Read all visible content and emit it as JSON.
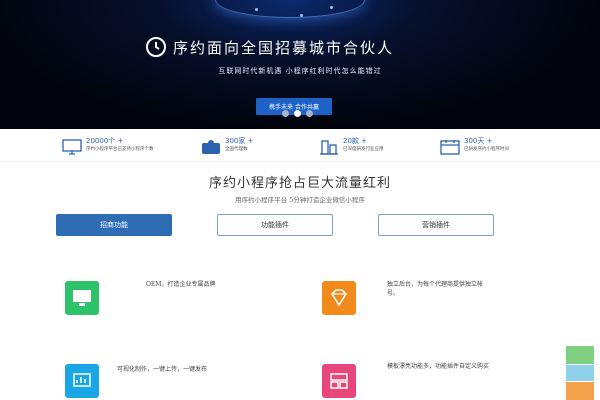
{
  "banner": {
    "title": "序约面向全国招募城市合伙人",
    "subtitle": "互联网时代新机遇 小程序红利时代怎么能错过",
    "cta_label": "携手未来 合作共赢",
    "icon": "clock-icon",
    "slides": 3,
    "active_slide": 1
  },
  "stats": [
    {
      "number": "20000个 +",
      "desc": "序约小程序平台已支持小程序个数",
      "icon": "monitor-icon"
    },
    {
      "number": "300家 +",
      "desc": "全国代理数",
      "icon": "handshake-icon"
    },
    {
      "number": "20款 +",
      "desc": "已深度研发行业应用",
      "icon": "building-icon"
    },
    {
      "number": "300天 +",
      "desc": "已研发序约小程序时间",
      "icon": "calendar-icon"
    }
  ],
  "section": {
    "title": "序约小程序抢占巨大流量红利",
    "subtitle": "用序约小程序平台 5分钟打造企业微信小程序"
  },
  "tabs": [
    {
      "label": "招商功能",
      "active": true
    },
    {
      "label": "功能插件",
      "active": false
    },
    {
      "label": "营销插件",
      "active": false
    }
  ],
  "features": [
    {
      "text": "OEM，打造企业专属品牌",
      "icon": "monitor-icon",
      "color": "#2ec26a"
    },
    {
      "text": "独立后台，为每个代理商提供独立帐号。",
      "icon": "diamond-icon",
      "color": "#f28a1c"
    },
    {
      "text": "可视化制作，一键上传，一键发布",
      "icon": "chart-eye-icon",
      "color": "#1aa6e6"
    },
    {
      "text": "模板漂亮功能多，功能插件自定义购买",
      "icon": "layout-icon",
      "color": "#e8467a"
    }
  ],
  "colors": {
    "accent": "#2e6db4",
    "banner_bg": "#02040d",
    "side_top": "#7fd081",
    "side_mid": "#8fd1e8",
    "side_bottom": "#f2a24b"
  }
}
